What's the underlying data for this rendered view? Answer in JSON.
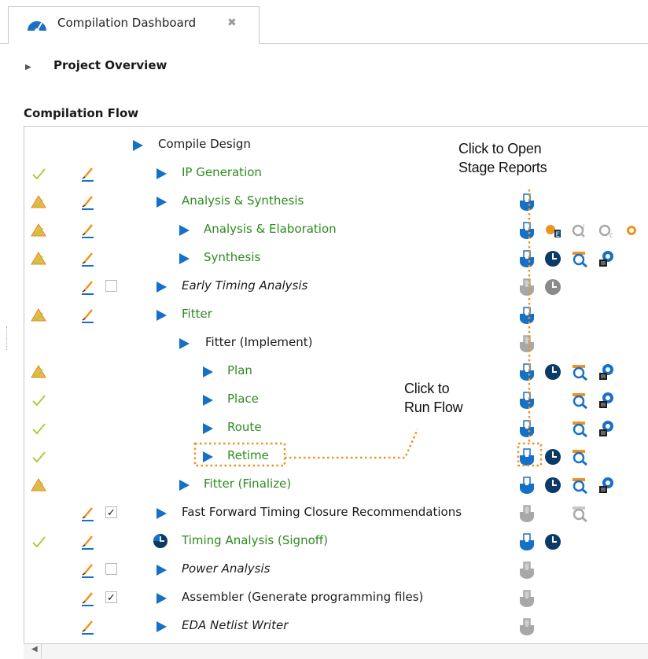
{
  "tab": {
    "title": "Compilation Dashboard",
    "close_glyph": "✖",
    "icon": "dashboard-gauge-icon"
  },
  "project_overview": {
    "label": "Project Overview"
  },
  "compilation_flow": {
    "label": "Compilation Flow"
  },
  "callouts": {
    "open_reports_line1": "Click to Open",
    "open_reports_line2": "Stage Reports",
    "run_flow_line1": "Click to",
    "run_flow_line2": "Run Flow"
  },
  "colors": {
    "accent_blue": "#1570c8",
    "stage_green": "#2e8b1f",
    "callout_orange": "#f0921e",
    "dark_navy": "#0b3a66",
    "check_green": "#a8cf3a"
  },
  "rows": [
    {
      "label": "Compile Design",
      "style": "dark",
      "status": "none",
      "pencil": false,
      "checkbox": "none"
    },
    {
      "label": "IP Generation",
      "style": "green",
      "status": "check",
      "pencil": true,
      "checkbox": "none"
    },
    {
      "label": "Analysis & Synthesis",
      "style": "green",
      "status": "warning",
      "pencil": true,
      "checkbox": "none"
    },
    {
      "label": "Analysis & Elaboration",
      "style": "green",
      "status": "warning",
      "pencil": true,
      "checkbox": "none"
    },
    {
      "label": "Synthesis",
      "style": "green",
      "status": "warning",
      "pencil": true,
      "checkbox": "none"
    },
    {
      "label": "Early Timing Analysis",
      "style": "italic",
      "status": "none",
      "pencil": true,
      "checkbox": "unchecked"
    },
    {
      "label": "Fitter",
      "style": "green",
      "status": "warning",
      "pencil": true,
      "checkbox": "none"
    },
    {
      "label": "Fitter (Implement)",
      "style": "dark",
      "status": "none",
      "pencil": false,
      "checkbox": "none"
    },
    {
      "label": "Plan",
      "style": "green",
      "status": "warning",
      "pencil": false,
      "checkbox": "none"
    },
    {
      "label": "Place",
      "style": "green",
      "status": "check",
      "pencil": false,
      "checkbox": "none"
    },
    {
      "label": "Route",
      "style": "green",
      "status": "check",
      "pencil": false,
      "checkbox": "none"
    },
    {
      "label": "Retime",
      "style": "green",
      "status": "check",
      "pencil": false,
      "checkbox": "none"
    },
    {
      "label": "Fitter (Finalize)",
      "style": "green",
      "status": "warning",
      "pencil": false,
      "checkbox": "none"
    },
    {
      "label": "Fast Forward Timing Closure Recommendations",
      "style": "dark",
      "status": "none",
      "pencil": true,
      "checkbox": "checked"
    },
    {
      "label": "Timing Analysis (Signoff)",
      "style": "green",
      "status": "check",
      "pencil": true,
      "checkbox": "none"
    },
    {
      "label": "Power Analysis",
      "style": "italic",
      "status": "none",
      "pencil": true,
      "checkbox": "unchecked"
    },
    {
      "label": "Assembler (Generate programming files)",
      "style": "dark",
      "status": "none",
      "pencil": true,
      "checkbox": "checked"
    },
    {
      "label": "EDA Netlist Writer",
      "style": "italic",
      "status": "none",
      "pencil": true,
      "checkbox": "none"
    }
  ],
  "checkbox_glyph": "✓"
}
